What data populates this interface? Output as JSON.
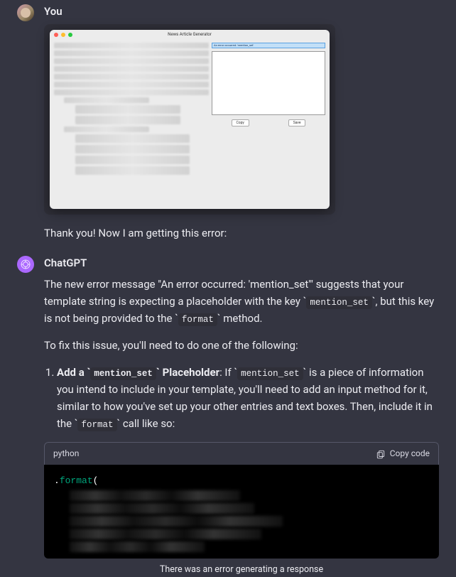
{
  "user": {
    "sender": "You",
    "attachment_title": "News Article Generator",
    "attachment_error": "An error occurred: 'mention_set'",
    "attachment_buttons": {
      "copy": "Copy",
      "save": "Save"
    },
    "message": "Thank you! Now I am getting this error:"
  },
  "assistant": {
    "sender": "ChatGPT",
    "p1_a": "The new error message \"An error occurred: 'mention_set'\" suggests that your template string is expecting a placeholder with the key ",
    "code1": "mention_set",
    "p1_b": ", but this key is not being provided to the ",
    "code2": "format",
    "p1_c": " method.",
    "p2": "To fix this issue, you'll need to do one of the following:",
    "li1_a": "Add a ",
    "li1_code1": "mention_set",
    "li1_b": " Placeholder",
    "li1_c": ": If ",
    "li1_code2": "mention_set",
    "li1_d": " is a piece of information you intend to include in your template, you'll need to add an input method for it, similar to how you've set up your other entries and text boxes. Then, include it in the ",
    "li1_code3": "format",
    "li1_e": " call like so:",
    "codeblock": {
      "lang": "python",
      "copy": "Copy code",
      "line1_dot": ".",
      "line1_fn": "format",
      "line1_paren": "("
    }
  },
  "footer_error": "There was an error generating a response"
}
